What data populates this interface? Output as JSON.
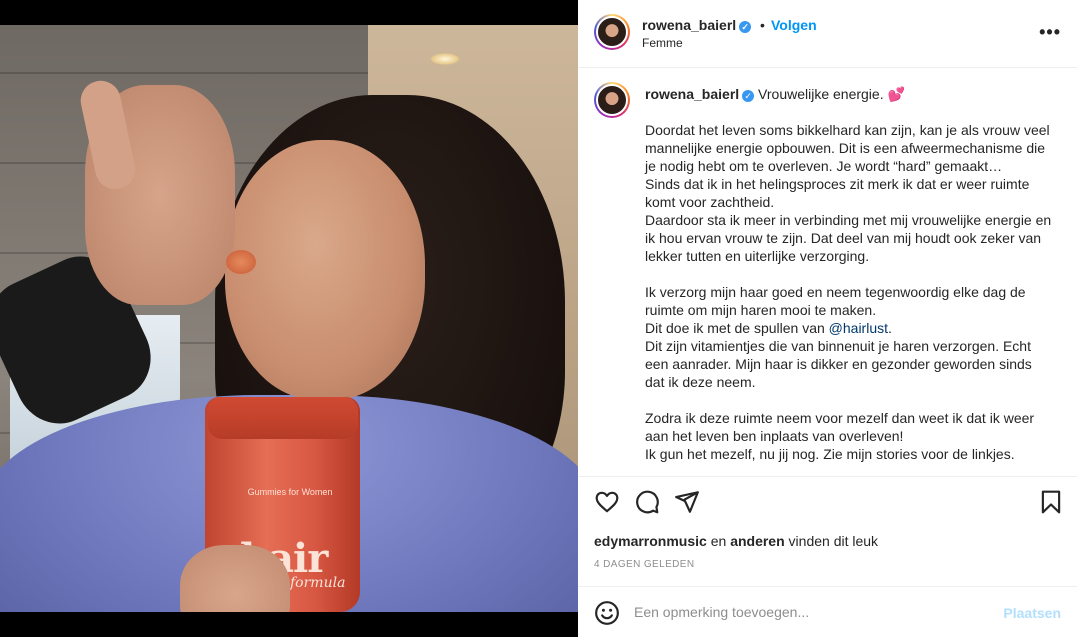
{
  "media": {
    "jar_small_text": "Gummies for Women",
    "jar_brand": "hair",
    "jar_sub": "formula"
  },
  "header": {
    "username": "rowena_baierl",
    "follow_label": "Volgen",
    "dot": "•",
    "location": "Femme",
    "more_label": "•••"
  },
  "caption": {
    "username": "rowena_baierl",
    "headline": "Vrouwelijke energie. 💕",
    "paragraph_1": "Doordat het leven soms bikkelhard kan zijn, kan je als vrouw veel mannelijke energie opbouwen. Dit is een afweermechanisme die je nodig hebt om te overleven. Je wordt “hard” gemaakt…\nSinds dat ik in het helingsproces zit merk ik dat er weer ruimte komt voor zachtheid.\nDaardoor sta ik meer in verbinding met mij vrouwelijke energie en ik hou ervan vrouw te zijn. Dat deel van mij houdt ook zeker van lekker tutten en uiterlijke verzorging.\n\nIk verzorg mijn haar goed en neem tegenwoordig elke dag de ruimte om mijn haren mooi te maken.\nDit doe ik met de spullen van ",
    "mention": "@hairlust",
    "paragraph_2": ".\nDit zijn vitamientjes die van binnenuit je haren verzorgen. Echt een aanrader. Mijn haar is dikker en gezonder geworden sinds dat ik deze neem.\n\nZodra ik deze ruimte neem voor mezelf dan weet ik dat ik weer aan het leven ben inplaats van overleven!\nIk gun het mezelf, nu jij nog. Zie mijn stories voor de linkjes."
  },
  "actions": {
    "liker": "edymarronmusic",
    "likes_mid": " en ",
    "likes_others": "anderen",
    "likes_tail": " vinden dit leuk",
    "time_ago": "4 DAGEN GELEDEN"
  },
  "comment": {
    "placeholder": "Een opmerking toevoegen...",
    "post_label": "Plaatsen"
  },
  "colors": {
    "link_blue": "#0095f6",
    "mention_blue": "#00376b",
    "post_disabled": "#b2dffc",
    "verified": "#3897f0"
  },
  "icons": [
    "heart-icon",
    "comment-icon",
    "share-icon",
    "bookmark-icon",
    "emoji-icon",
    "verified-icon",
    "more-icon"
  ]
}
